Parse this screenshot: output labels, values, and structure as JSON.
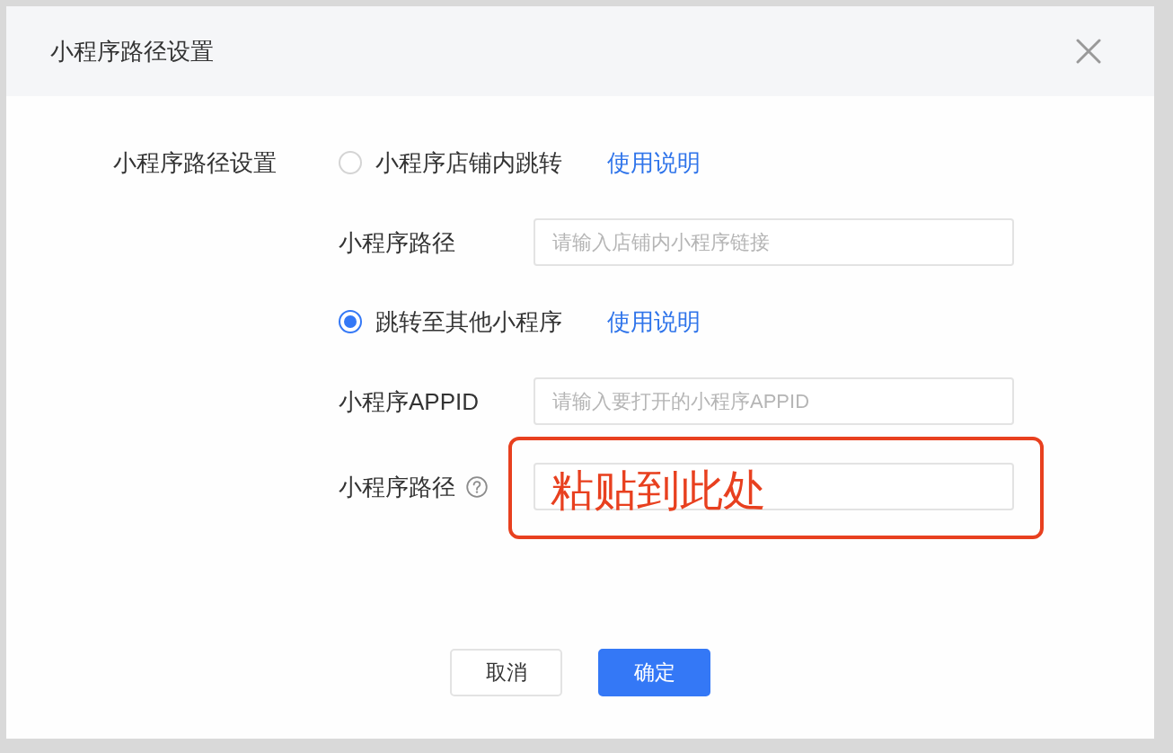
{
  "dialog": {
    "title": "小程序路径设置"
  },
  "form": {
    "label": "小程序路径设置",
    "options": [
      {
        "label": "小程序店铺内跳转",
        "selected": false,
        "link": "使用说明",
        "fields": [
          {
            "label": "小程序路径",
            "placeholder": "请输入店铺内小程序链接"
          }
        ]
      },
      {
        "label": "跳转至其他小程序",
        "selected": true,
        "link": "使用说明",
        "fields": [
          {
            "label": "小程序APPID",
            "placeholder": "请输入要打开的小程序APPID"
          },
          {
            "label": "小程序路径",
            "help": true,
            "annotation": {
              "text": "粘贴到此处"
            }
          }
        ]
      }
    ]
  },
  "buttons": [
    {
      "label": "取消",
      "kind": "default"
    },
    {
      "label": "确定",
      "kind": "primary"
    }
  ]
}
